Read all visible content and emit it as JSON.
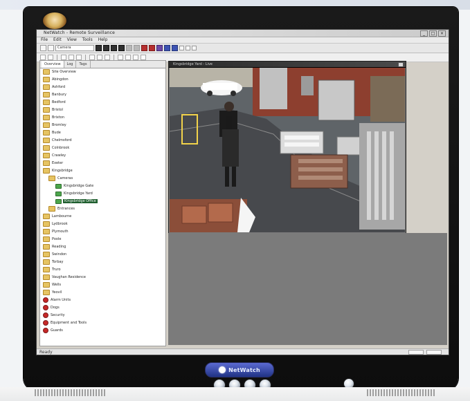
{
  "window": {
    "title": "NetWatch - Remote Surveillance",
    "controls": [
      "_",
      "□",
      "×"
    ]
  },
  "menubar": {
    "items": [
      "File",
      "Edit",
      "View",
      "Tools",
      "Help"
    ]
  },
  "toolbar": {
    "combo_value": "Camera"
  },
  "tree": {
    "tabs": [
      "Overview",
      "Log",
      "Tags"
    ],
    "items": [
      {
        "label": "Site Overview",
        "type": "folder",
        "selected": false
      },
      {
        "label": "Abingdon",
        "type": "folder",
        "selected": false
      },
      {
        "label": "Ashford",
        "type": "folder",
        "selected": false
      },
      {
        "label": "Banbury",
        "type": "folder",
        "selected": false
      },
      {
        "label": "Bedford",
        "type": "folder",
        "selected": false
      },
      {
        "label": "Bristol",
        "type": "folder",
        "selected": false
      },
      {
        "label": "Brixton",
        "type": "folder",
        "selected": false
      },
      {
        "label": "Bromley",
        "type": "folder",
        "selected": false
      },
      {
        "label": "Bude",
        "type": "folder",
        "selected": false
      },
      {
        "label": "Chelmsford",
        "type": "folder",
        "selected": false
      },
      {
        "label": "Colnbrook",
        "type": "folder",
        "selected": false
      },
      {
        "label": "Crawley",
        "type": "folder",
        "selected": false
      },
      {
        "label": "Exeter",
        "type": "folder",
        "selected": false
      },
      {
        "label": "Kingsbridge",
        "type": "folder",
        "selected": false
      },
      {
        "label": "Cameras",
        "type": "folder",
        "selected": false
      },
      {
        "label": "Kingsbridge Gate",
        "type": "cam",
        "selected": false
      },
      {
        "label": "Kingsbridge Yard",
        "type": "cam",
        "selected": false
      },
      {
        "label": "Kingsbridge Office",
        "type": "cam",
        "selected": true
      },
      {
        "label": "Entrances",
        "type": "folder",
        "selected": false
      },
      {
        "label": "Lambourne",
        "type": "folder",
        "selected": false
      },
      {
        "label": "Lydbrook",
        "type": "folder",
        "selected": false
      },
      {
        "label": "Plymouth",
        "type": "folder",
        "selected": false
      },
      {
        "label": "Poole",
        "type": "folder",
        "selected": false
      },
      {
        "label": "Reading",
        "type": "folder",
        "selected": false
      },
      {
        "label": "Swindon",
        "type": "folder",
        "selected": false
      },
      {
        "label": "Torbay",
        "type": "folder",
        "selected": false
      },
      {
        "label": "Truro",
        "type": "folder",
        "selected": false
      },
      {
        "label": "Vaughan Residence",
        "type": "folder",
        "selected": false
      },
      {
        "label": "Wells",
        "type": "folder",
        "selected": false
      },
      {
        "label": "Yeovil",
        "type": "folder",
        "selected": false
      },
      {
        "label": "Alarm Units",
        "type": "red",
        "selected": false
      },
      {
        "label": "Dogs",
        "type": "red",
        "selected": false
      },
      {
        "label": "Security",
        "type": "red",
        "selected": false
      },
      {
        "label": "Equipment and Tools",
        "type": "red",
        "selected": false
      },
      {
        "label": "Guards",
        "type": "red",
        "selected": false
      }
    ]
  },
  "video": {
    "title": "Kingsbridge Yard - Live"
  },
  "status": {
    "text": "Ready"
  },
  "brand": {
    "label": "NetWatch"
  }
}
